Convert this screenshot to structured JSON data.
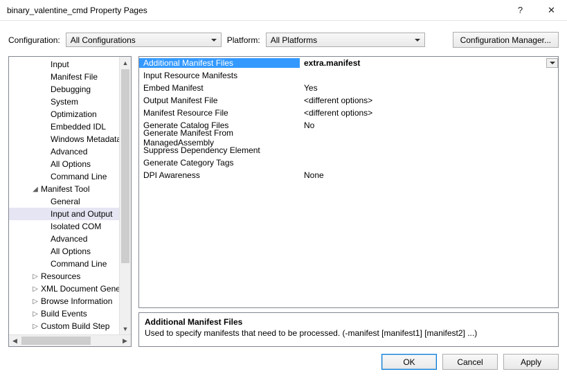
{
  "window": {
    "title": "binary_valentine_cmd Property Pages",
    "help_symbol": "?",
    "close_symbol": "✕"
  },
  "toolbar": {
    "configuration_label": "Configuration:",
    "configuration_value": "All Configurations",
    "platform_label": "Platform:",
    "platform_value": "All Platforms",
    "config_manager_label": "Configuration Manager..."
  },
  "tree": {
    "items": [
      {
        "label": "Input",
        "indent": 60,
        "expander": ""
      },
      {
        "label": "Manifest File",
        "indent": 60,
        "expander": ""
      },
      {
        "label": "Debugging",
        "indent": 60,
        "expander": ""
      },
      {
        "label": "System",
        "indent": 60,
        "expander": ""
      },
      {
        "label": "Optimization",
        "indent": 60,
        "expander": ""
      },
      {
        "label": "Embedded IDL",
        "indent": 60,
        "expander": ""
      },
      {
        "label": "Windows Metadata",
        "indent": 60,
        "expander": ""
      },
      {
        "label": "Advanced",
        "indent": 60,
        "expander": ""
      },
      {
        "label": "All Options",
        "indent": 60,
        "expander": ""
      },
      {
        "label": "Command Line",
        "indent": 60,
        "expander": ""
      },
      {
        "label": "Manifest Tool",
        "indent": 46,
        "expander": "◢",
        "exp_at": 32
      },
      {
        "label": "General",
        "indent": 60,
        "expander": ""
      },
      {
        "label": "Input and Output",
        "indent": 60,
        "expander": "",
        "selected": true
      },
      {
        "label": "Isolated COM",
        "indent": 60,
        "expander": ""
      },
      {
        "label": "Advanced",
        "indent": 60,
        "expander": ""
      },
      {
        "label": "All Options",
        "indent": 60,
        "expander": ""
      },
      {
        "label": "Command Line",
        "indent": 60,
        "expander": ""
      },
      {
        "label": "Resources",
        "indent": 46,
        "expander": "▷",
        "exp_at": 32
      },
      {
        "label": "XML Document Genera",
        "indent": 46,
        "expander": "▷",
        "exp_at": 32
      },
      {
        "label": "Browse Information",
        "indent": 46,
        "expander": "▷",
        "exp_at": 32
      },
      {
        "label": "Build Events",
        "indent": 46,
        "expander": "▷",
        "exp_at": 32
      },
      {
        "label": "Custom Build Step",
        "indent": 46,
        "expander": "▷",
        "exp_at": 32
      }
    ]
  },
  "grid": {
    "rows": [
      {
        "name": "Additional Manifest Files",
        "value": "extra.manifest",
        "selected": true
      },
      {
        "name": "Input Resource Manifests",
        "value": ""
      },
      {
        "name": "Embed Manifest",
        "value": "Yes"
      },
      {
        "name": "Output Manifest File",
        "value": "<different options>"
      },
      {
        "name": "Manifest Resource File",
        "value": "<different options>"
      },
      {
        "name": "Generate Catalog Files",
        "value": "No"
      },
      {
        "name": "Generate Manifest From ManagedAssembly",
        "value": ""
      },
      {
        "name": "Suppress Dependency Element",
        "value": ""
      },
      {
        "name": "Generate Category Tags",
        "value": ""
      },
      {
        "name": "DPI Awareness",
        "value": "None"
      }
    ]
  },
  "description": {
    "title": "Additional Manifest Files",
    "text": "Used to specify manifests that need to be processed. (-manifest [manifest1] [manifest2] ...)"
  },
  "buttons": {
    "ok": "OK",
    "cancel": "Cancel",
    "apply": "Apply"
  }
}
